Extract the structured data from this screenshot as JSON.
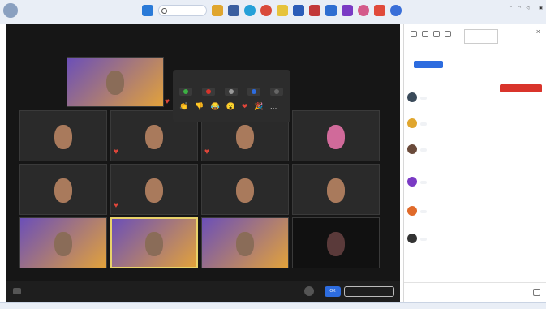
{
  "titlebar": {
    "line1": "",
    "line2": "",
    "search_placeholder": "",
    "right_text": ""
  },
  "meeting": {
    "reactions_title": "",
    "reactions_label": "",
    "tiles": [
      {
        "name": ""
      },
      {
        "name": ""
      },
      {
        "name": ""
      },
      {
        "name": ""
      },
      {
        "name": ""
      },
      {
        "name": ""
      },
      {
        "name": ""
      },
      {
        "name": ""
      },
      {
        "name": ""
      },
      {
        "name": ""
      },
      {
        "name": ""
      },
      {
        "name": ""
      },
      {
        "name": ""
      },
      {
        "name": ""
      },
      {
        "name": ""
      },
      {
        "name": ""
      },
      {
        "name": ""
      }
    ],
    "reaction_emojis": [
      "👏",
      "👎",
      "😂",
      "😮",
      "❤",
      "🎉",
      "…"
    ]
  },
  "controlbar": {
    "message": "",
    "ok_label": "OK",
    "leave_label": ""
  },
  "chat": {
    "tip": "",
    "meta": "",
    "button_label": "",
    "system_line": "",
    "red_button": "",
    "messages": [
      {
        "meta": "",
        "text": ""
      },
      {
        "meta": "",
        "text": ""
      },
      {
        "meta": "",
        "text": ""
      },
      {
        "meta": "",
        "text": ""
      },
      {
        "meta": "",
        "text": ""
      },
      {
        "meta": "",
        "text": ""
      }
    ],
    "input_placeholder": ""
  },
  "bottombar": {
    "text": ""
  },
  "colors": {
    "accent_blue": "#2d6cdf",
    "alert_red": "#d9342b",
    "stage_bg": "#161616",
    "active_speaker": "#e8d26a"
  }
}
